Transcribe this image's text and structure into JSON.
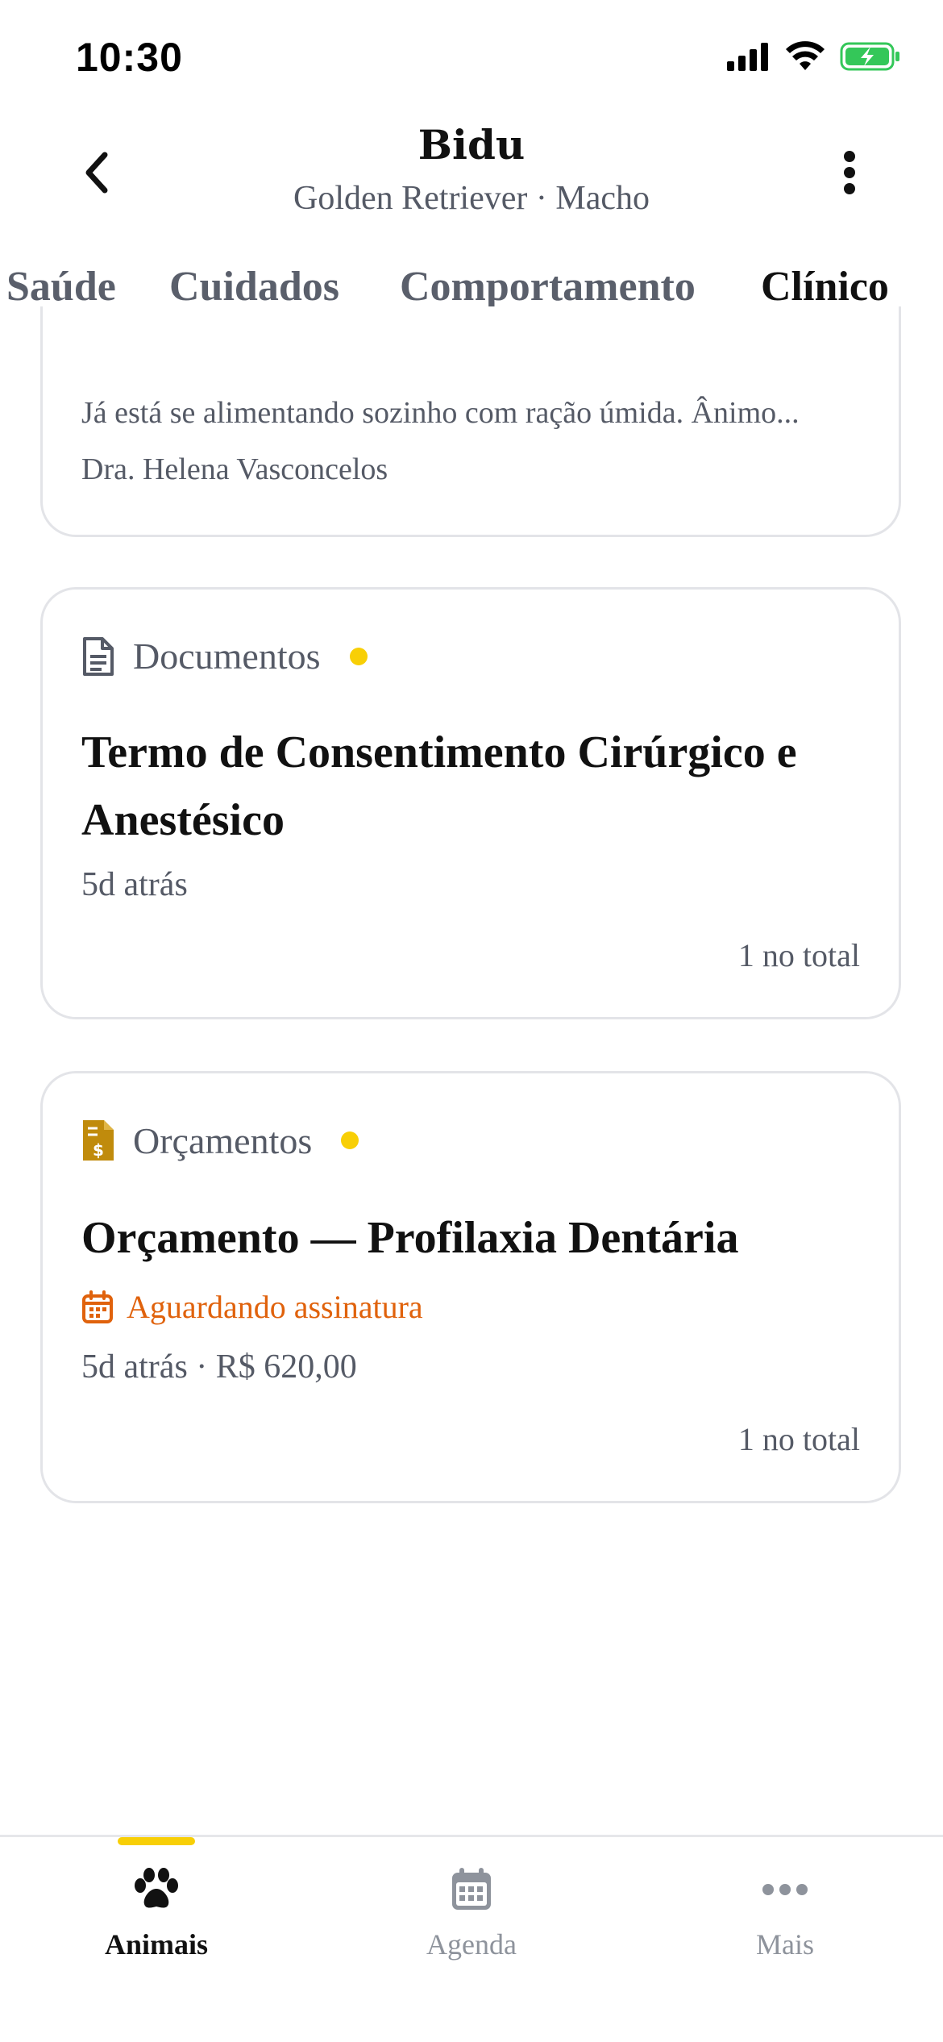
{
  "status_bar": {
    "time": "10:30",
    "icons": [
      "signal-icon",
      "wifi-icon",
      "battery-charging-icon"
    ],
    "battery_color": "#34c759"
  },
  "header": {
    "title": "Bidu",
    "subtitle": "Golden Retriever · Macho",
    "back_icon": "chevron-left-icon",
    "more_icon": "more-vertical-icon"
  },
  "tabs": [
    {
      "label": "Saúde",
      "active": false
    },
    {
      "label": "Cuidados",
      "active": false
    },
    {
      "label": "Comportamento",
      "active": false
    },
    {
      "label": "Clínico",
      "active": true
    }
  ],
  "accent_color": "#f8cf06",
  "partial_card": {
    "note": "Já está se alimentando sozinho com ração úmida. Ânimo...",
    "doctor": "Dra. Helena Vasconcelos"
  },
  "documents_card": {
    "category": "Documentos",
    "icon": "document-icon",
    "title": "Termo de Consentimento Cirúrgico e Anestésico",
    "meta": "5d atrás",
    "total": "1 no total"
  },
  "budget_card": {
    "category": "Orçamentos",
    "icon": "invoice-dollar-icon",
    "title": "Orçamento — Profilaxia Dentária",
    "status_icon": "calendar-icon",
    "status": "Aguardando assinatura",
    "status_color": "#e0620c",
    "meta": "5d atrás · R$ 620,00",
    "total": "1 no total"
  },
  "bottom_nav": [
    {
      "label": "Animais",
      "icon": "paw-icon",
      "active": true
    },
    {
      "label": "Agenda",
      "icon": "calendar-icon",
      "active": false
    },
    {
      "label": "Mais",
      "icon": "more-horizontal-icon",
      "active": false
    }
  ]
}
